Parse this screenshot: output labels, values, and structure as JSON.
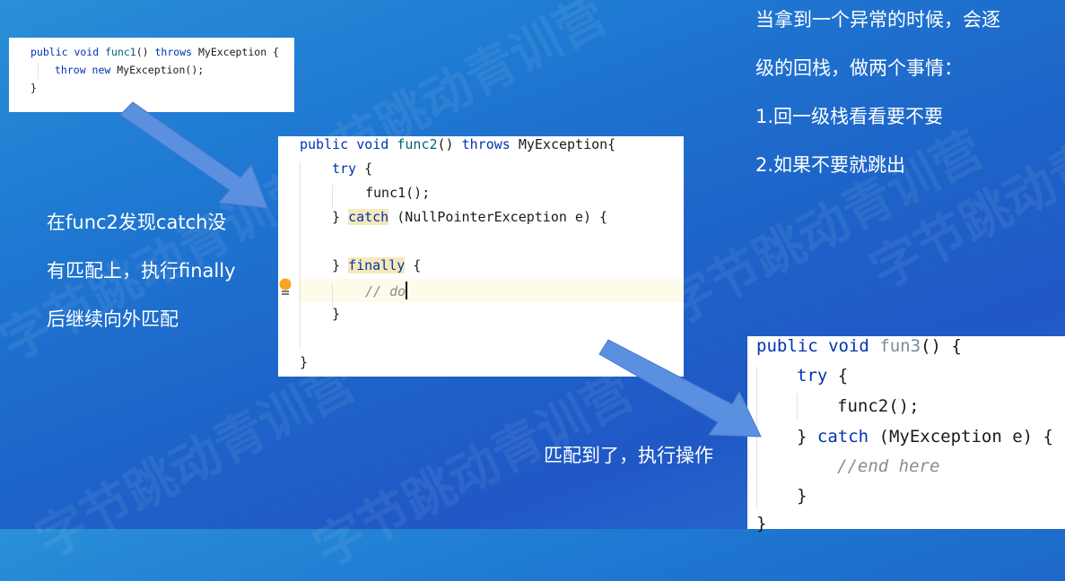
{
  "watermark_text": "字节跳动青训营",
  "box1": {
    "lines": [
      {
        "kw1": "public void ",
        "fn": "func1",
        "rest": "() ",
        "kw2": "throws",
        "tail": " MyException {"
      },
      {
        "kw": "throw new",
        "tail": " MyException();"
      },
      {
        "tail": "}"
      }
    ]
  },
  "box2": {
    "l1": {
      "kw1": "public void ",
      "fn": "func2",
      "rest": "() ",
      "kw2": "throws",
      "tail": " MyException{"
    },
    "l2": {
      "kw": "try",
      "tail": " {"
    },
    "l3": "func1();",
    "l4": {
      "pre": "} ",
      "kw": "catch",
      "tail": " (NullPointerException e) {"
    },
    "l6": {
      "pre": "} ",
      "kw": "finally",
      "tail": " {"
    },
    "l7": "// do",
    "l8": "}",
    "l10": "}"
  },
  "box3": {
    "l1": {
      "kw1": "public void ",
      "fn": "fun3",
      "tail": "() {"
    },
    "l2": {
      "kw": "try",
      "tail": " {"
    },
    "l3": "func2();",
    "l4": {
      "pre": "} ",
      "kw": "catch",
      "tail": " (MyException e) {"
    },
    "l5": "//end here",
    "l6": "}",
    "l7": "}"
  },
  "captions": {
    "right_1": "当拿到一个异常的时候，会逐",
    "right_2": "级的回栈，做两个事情：",
    "right_3": "1.回一级栈看看要不要",
    "right_4": "2.如果不要就跳出",
    "left_1": "在func2发现catch没",
    "left_2": "有匹配上，执行finally",
    "left_3": "后继续向外匹配",
    "bottom": "匹配到了，执行操作"
  },
  "colors": {
    "keyword": "#0033b3",
    "function": "#00627a",
    "comment": "#8c8c8c",
    "highlight": "#f7e8b9",
    "arrow": "#5b8fe0"
  },
  "icons": {
    "hint": "lightbulb-icon"
  }
}
